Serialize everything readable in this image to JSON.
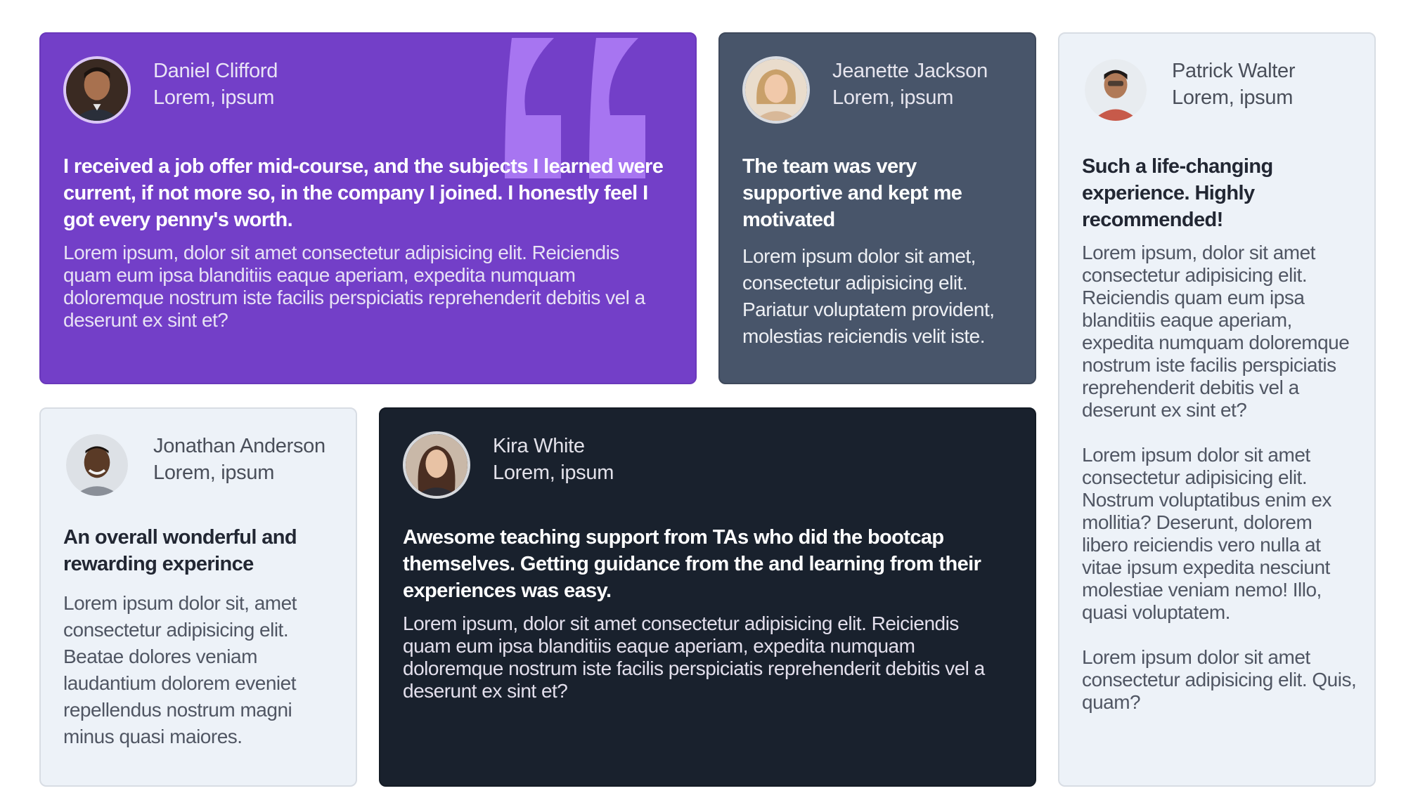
{
  "colors": {
    "purple_card": "#733fc8",
    "slate_card": "#48556a",
    "dark_card": "#19212d",
    "light_card": "#edf2f8",
    "quote_mark": "#a775f1"
  },
  "testimonials": [
    {
      "name": "Daniel Clifford",
      "role": "Lorem, ipsum",
      "title": "I received a job offer mid-course, and the subjects I learned were current, if not more so, in the company I joined. I honestly feel I got every penny's worth.",
      "body": "Lorem ipsum, dolor sit amet consectetur adipisicing elit. Reiciendis quam eum ipsa blanditiis eaque aperiam, expedita numquam doloremque nostrum iste facilis perspiciatis reprehenderit debitis vel a deserunt ex sint et?"
    },
    {
      "name": "Jeanette Jackson",
      "role": "Lorem, ipsum",
      "title": "The team was very supportive and kept me motivated",
      "body": "Lorem ipsum dolor sit amet, consectetur adipisicing elit. Pariatur voluptatem provident, molestias reiciendis velit iste."
    },
    {
      "name": "Patrick Walter",
      "role": "Lorem, ipsum",
      "title": "Such a life-changing experience. Highly recommended!",
      "body_paragraphs": [
        "Lorem ipsum, dolor sit amet consectetur adipisicing elit. Reiciendis quam eum ipsa blanditiis eaque aperiam, expedita numquam doloremque nostrum iste facilis perspiciatis reprehenderit debitis vel a deserunt ex sint et?",
        "Lorem ipsum dolor sit amet consectetur adipisicing elit. Nostrum voluptatibus enim ex mollitia? Deserunt, dolorem libero reiciendis vero nulla at vitae ipsum expedita nesciunt molestiae veniam nemo! Illo, quasi voluptatem.",
        "Lorem ipsum dolor sit amet consectetur adipisicing elit. Quis, quam?"
      ]
    },
    {
      "name": "Jonathan Anderson",
      "role": "Lorem, ipsum",
      "title": "An overall wonderful and rewarding experince",
      "body": "Lorem ipsum dolor sit, amet consectetur adipisicing elit. Beatae dolores veniam laudantium dolorem eveniet repellendus nostrum magni minus quasi maiores."
    },
    {
      "name": "Kira White",
      "role": "Lorem, ipsum",
      "title": "Awesome teaching support from TAs who did the bootcap themselves. Getting guidance from the and learning from their experiences was easy.",
      "body": "Lorem ipsum, dolor sit amet consectetur adipisicing elit. Reiciendis quam eum ipsa blanditiis eaque aperiam, expedita numquam doloremque nostrum iste facilis perspiciatis reprehenderit debitis vel a deserunt ex sint et?"
    }
  ]
}
